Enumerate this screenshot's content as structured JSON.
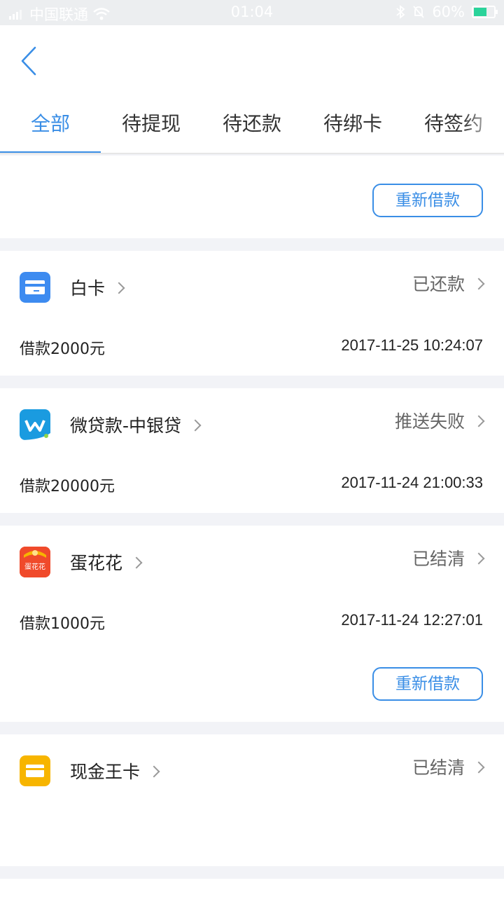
{
  "status_bar": {
    "carrier": "中国联通",
    "time": "01:04",
    "battery": "60%",
    "battery_level": 0.6
  },
  "tabs": [
    {
      "label": "全部",
      "active": true
    },
    {
      "label": "待提现",
      "active": false
    },
    {
      "label": "待还款",
      "active": false
    },
    {
      "label": "待绑卡",
      "active": false
    },
    {
      "label": "待签约",
      "active": false
    }
  ],
  "top_action": {
    "label": "重新借款"
  },
  "loans": [
    {
      "name": "白卡",
      "status": "已还款",
      "amount": "借款2000元",
      "date": "2017-11-25 10:24:07",
      "icon": "card-icon",
      "icon_color": "#3d8bf0"
    },
    {
      "name": "微贷款-中银贷",
      "status": "推送失败",
      "amount": "借款20000元",
      "date": "2017-11-24 21:00:33",
      "icon": "w-logo-icon",
      "icon_color": "#1a9be0"
    },
    {
      "name": "蛋花花",
      "status": "已结清",
      "amount": "借款1000元",
      "date": "2017-11-24 12:27:01",
      "icon": "danhuahua-logo-icon",
      "icon_color": "#f04a2b",
      "icon_text": "蛋花花",
      "action": "重新借款"
    },
    {
      "name": "现金王卡",
      "status": "已结清",
      "icon": "wallet-icon",
      "icon_color": "#f7b500"
    }
  ],
  "colors": {
    "accent": "#3a8ee6",
    "background": "#f2f3f7"
  }
}
